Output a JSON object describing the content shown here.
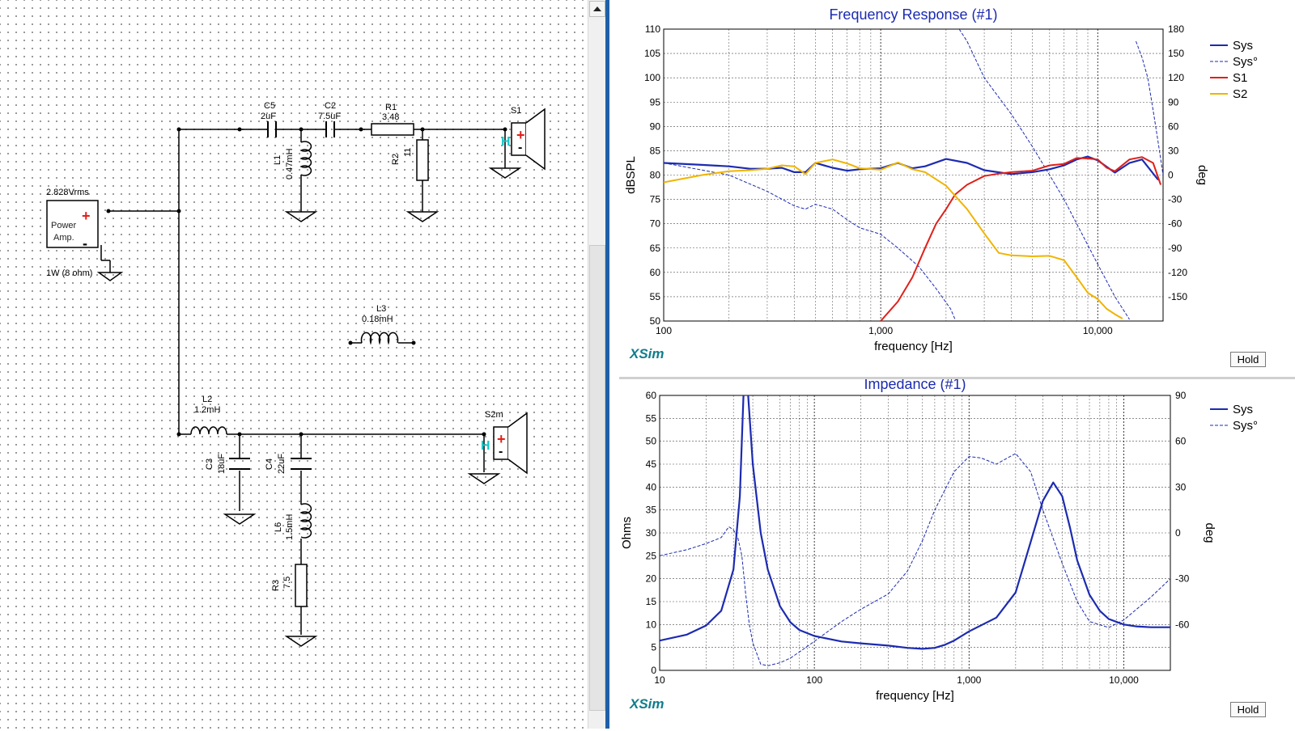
{
  "schematic": {
    "source": {
      "voltage": "2.828Vrms",
      "name_line1": "Power",
      "name_line2": "Amp.",
      "rating": "1W (8 ohm)"
    },
    "components": {
      "C5": {
        "ref": "C5",
        "value": "2uF"
      },
      "C2": {
        "ref": "C2",
        "value": "7.5uF"
      },
      "R1": {
        "ref": "R1",
        "value": "3.48"
      },
      "L1": {
        "ref": "L1",
        "value": "0.47mH"
      },
      "R2": {
        "ref": "R2",
        "value": "11"
      },
      "S1": {
        "ref": "S1"
      },
      "L3": {
        "ref": "L3",
        "value": "0.18mH"
      },
      "L2": {
        "ref": "L2",
        "value": "1.2mH"
      },
      "C3": {
        "ref": "C3",
        "value": "18uF"
      },
      "C4": {
        "ref": "C4",
        "value": "22uF"
      },
      "L6": {
        "ref": "L6",
        "value": "1.5mH"
      },
      "R3": {
        "ref": "R3",
        "value": "7.5"
      },
      "S2m": {
        "ref": "S2m"
      }
    },
    "speaker_terminal_label": "H",
    "plus_sign": "+",
    "minus_sign": "-"
  },
  "colors": {
    "sys": "#1c2bb0",
    "s1": "#e0201a",
    "s2": "#f0b400",
    "title": "#1c2bb0",
    "brand": "#0f7d8c"
  },
  "hold_label": "Hold",
  "brand_label": "XSim",
  "chart_data": [
    {
      "type": "line",
      "title": "Frequency Response (#1)",
      "xlabel": "frequency [Hz]",
      "ylabel": "dBSPL",
      "y2label": "deg",
      "xscale": "log",
      "xlim": [
        100,
        20000
      ],
      "ylim": [
        50,
        110
      ],
      "y2lim": [
        -180,
        180
      ],
      "x_ticks": [
        "100",
        "1,000",
        "10,000"
      ],
      "y_ticks": [
        "50",
        "55",
        "60",
        "65",
        "70",
        "75",
        "80",
        "85",
        "90",
        "95",
        "100",
        "105",
        "110"
      ],
      "y2_ticks": [
        "-150",
        "-120",
        "-90",
        "-60",
        "-30",
        "0",
        "30",
        "60",
        "90",
        "120",
        "150",
        "180"
      ],
      "grid": true,
      "legend_position": "right",
      "series": [
        {
          "name": "Sys",
          "color": "#1c2bb0",
          "style": "solid",
          "axis": "left",
          "x": [
            100,
            150,
            200,
            250,
            300,
            350,
            400,
            450,
            500,
            600,
            700,
            800,
            1000,
            1200,
            1400,
            1600,
            2000,
            2500,
            3000,
            4000,
            5000,
            6000,
            7000,
            8000,
            9000,
            10000,
            12000,
            14000,
            16000,
            19000
          ],
          "y": [
            82.5,
            82.1,
            81.8,
            81.3,
            81.3,
            81.5,
            80.6,
            80.6,
            82.5,
            81.5,
            80.9,
            81.2,
            81.4,
            82.5,
            81.4,
            81.8,
            83.3,
            82.5,
            81.0,
            80.2,
            80.6,
            81.2,
            82.0,
            83.2,
            83.8,
            83.0,
            80.5,
            82.5,
            83.2,
            79.0
          ]
        },
        {
          "name": "Sys°",
          "color": "#1c2bb0",
          "style": "dashed",
          "axis": "right",
          "x": [
            100,
            200,
            300,
            400,
            450,
            500,
            600,
            700,
            800,
            1000,
            1200,
            1500,
            1800,
            2100,
            2200,
            2300,
            2500,
            3000,
            4000,
            5000,
            6000,
            7000,
            8000,
            10000,
            12000,
            14000,
            15000,
            16000,
            17000,
            18000,
            19000,
            20000
          ],
          "y": [
            15,
            0,
            -20,
            -38,
            -42,
            -36,
            -42,
            -55,
            -65,
            -73,
            -90,
            -113,
            -140,
            -165,
            -178,
            180,
            165,
            120,
            75,
            35,
            0,
            -30,
            -60,
            -110,
            -150,
            -178,
            165,
            145,
            120,
            80,
            40,
            0
          ]
        },
        {
          "name": "S1",
          "color": "#e0201a",
          "style": "solid",
          "axis": "left",
          "x": [
            1000,
            1200,
            1400,
            1600,
            1800,
            2000,
            2200,
            2500,
            3000,
            3500,
            4000,
            5000,
            6000,
            7000,
            8000,
            9000,
            10000,
            11000,
            12000,
            14000,
            16000,
            18000,
            19500
          ],
          "y": [
            50,
            54,
            59,
            65,
            70,
            73,
            76,
            78,
            79.8,
            80.3,
            80.6,
            80.9,
            82,
            82.3,
            83.5,
            83.4,
            83.2,
            81.5,
            80.8,
            83.2,
            83.7,
            82.5,
            78
          ]
        },
        {
          "name": "S2",
          "color": "#f0b400",
          "style": "solid",
          "axis": "left",
          "x": [
            100,
            150,
            200,
            250,
            300,
            350,
            400,
            450,
            500,
            600,
            700,
            800,
            1000,
            1200,
            1400,
            1600,
            2000,
            2500,
            3000,
            3500,
            4000,
            5000,
            6000,
            7000,
            8000,
            9000,
            10000,
            11000,
            12000,
            13000
          ],
          "y": [
            78.5,
            80,
            80.8,
            81,
            81.3,
            82,
            81.8,
            80.2,
            82.5,
            83.2,
            82.4,
            81.4,
            81.1,
            82.6,
            81.2,
            80.6,
            77.8,
            73,
            68,
            64,
            63.5,
            63.3,
            63.4,
            62.5,
            59,
            55.8,
            54.5,
            52.5,
            51.4,
            50.5
          ]
        }
      ]
    },
    {
      "type": "line",
      "title": "Impedance (#1)",
      "xlabel": "frequency [Hz]",
      "ylabel": "Ohms",
      "y2label": "deg",
      "xscale": "log",
      "xlim": [
        10,
        20000
      ],
      "ylim": [
        0,
        60
      ],
      "y2lim": [
        -90,
        90
      ],
      "x_ticks": [
        "10",
        "100",
        "1,000",
        "10,000"
      ],
      "y_ticks": [
        "0",
        "5",
        "10",
        "15",
        "20",
        "25",
        "30",
        "35",
        "40",
        "45",
        "50",
        "55",
        "60"
      ],
      "y2_ticks": [
        "-60",
        "-30",
        "0",
        "30",
        "60",
        "90"
      ],
      "grid": true,
      "legend_position": "right",
      "series": [
        {
          "name": "Sys",
          "color": "#1c2bb0",
          "style": "solid",
          "axis": "left",
          "x": [
            10,
            15,
            20,
            25,
            30,
            33,
            35,
            37,
            40,
            45,
            50,
            60,
            70,
            80,
            100,
            150,
            200,
            300,
            400,
            500,
            600,
            700,
            800,
            1000,
            1500,
            2000,
            2500,
            3000,
            3500,
            4000,
            4500,
            5000,
            6000,
            7000,
            8000,
            10000,
            12000,
            15000,
            20000
          ],
          "y": [
            6.5,
            7.8,
            9.8,
            13,
            22,
            38,
            62,
            62,
            45,
            30,
            22,
            14,
            10.5,
            8.8,
            7.5,
            6.3,
            5.9,
            5.4,
            4.9,
            4.7,
            4.9,
            5.6,
            6.5,
            8.5,
            11.5,
            17,
            28,
            37,
            41,
            38,
            31,
            24,
            16.5,
            13,
            11.2,
            10,
            9.6,
            9.4,
            9.4
          ]
        },
        {
          "name": "Sys°",
          "color": "#1c2bb0",
          "style": "dashed",
          "axis": "right",
          "x": [
            10,
            15,
            20,
            25,
            28,
            30,
            32,
            34,
            36,
            38,
            40,
            45,
            50,
            60,
            70,
            80,
            100,
            150,
            200,
            300,
            400,
            500,
            600,
            800,
            1000,
            1200,
            1500,
            2000,
            2500,
            3000,
            4000,
            5000,
            6000,
            8000,
            10000,
            15000,
            20000
          ],
          "y": [
            -15,
            -11,
            -7,
            -3,
            4,
            2,
            -3,
            -15,
            -40,
            -60,
            -72,
            -86,
            -87,
            -85,
            -82,
            -78,
            -71,
            -58,
            -50,
            -40,
            -25,
            -5,
            15,
            40,
            50,
            49,
            45,
            52,
            40,
            15,
            -20,
            -45,
            -58,
            -62,
            -57,
            -42,
            -30
          ]
        }
      ]
    }
  ]
}
